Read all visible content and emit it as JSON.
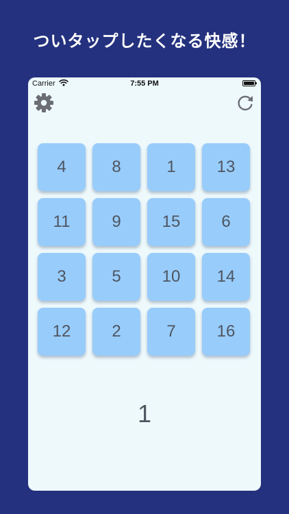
{
  "headline": "ついタップしたくなる快感！",
  "status_bar": {
    "carrier": "Carrier",
    "time": "7:55 PM",
    "wifi_icon": "wifi-icon",
    "battery_icon": "battery-icon"
  },
  "toolbar": {
    "settings_icon": "gear-icon",
    "reset_icon": "refresh-icon"
  },
  "grid": {
    "tiles": [
      "4",
      "8",
      "1",
      "13",
      "11",
      "9",
      "15",
      "6",
      "3",
      "5",
      "10",
      "14",
      "12",
      "2",
      "7",
      "16"
    ]
  },
  "counter": "1",
  "colors": {
    "background": "#24317e",
    "screen": "#eef9fc",
    "tile": "#98ccfb",
    "tile_text": "#4e5560",
    "icon": "#6b6e74"
  }
}
